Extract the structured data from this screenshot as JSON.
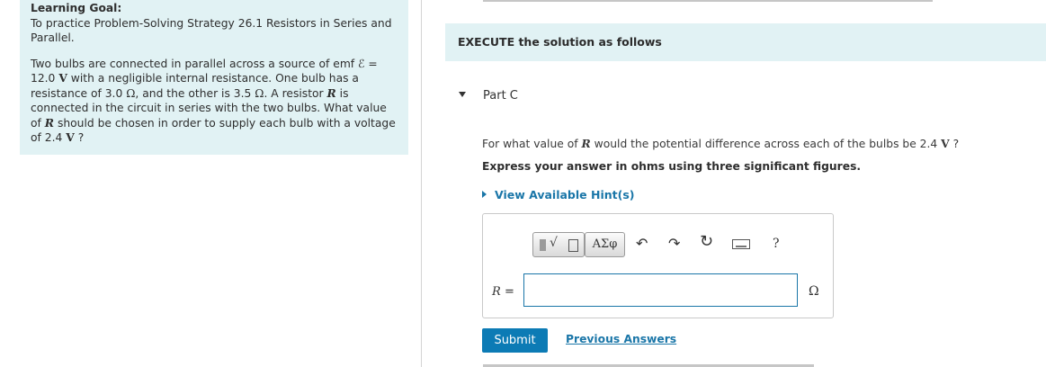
{
  "goal": {
    "title": "Learning Goal:",
    "subtitle": "To practice Problem-Solving Strategy 26.1 Resistors in Series and Parallel.",
    "p1": "Two bulbs are connected in parallel across a source of emf",
    "emf_symbol": "ℰ",
    "p2": "=",
    "p3": "12.0",
    "volt": "V",
    "p4": "with a negligible internal resistance. One bulb has a resistance of 3.0",
    "ohm": "Ω",
    "p5": ", and the other is 3.5",
    "p6": ". A resistor",
    "R": "R",
    "p7": "is connected in the circuit in series with the two bulbs. What value of",
    "p8": "should be chosen in order to supply each bulb with a voltage of 2.4",
    "p9": "?"
  },
  "execute": "EXECUTE the solution as follows",
  "part": {
    "title": "Part C"
  },
  "question": {
    "q1": "For what value of",
    "R": "R",
    "q2": "would the potential difference across each of the bulbs be 2.4",
    "volt": "V",
    "q3": "?",
    "instruction": "Express your answer in ohms using three significant figures."
  },
  "hint": {
    "label": "View Available Hint(s)"
  },
  "toolbar": {
    "templates_icon": "templates-radical-icon",
    "greek_label": "ΑΣφ",
    "undo_glyph": "↶",
    "redo_glyph": "↷",
    "reset_glyph": "↻",
    "keyboard_icon": "keyboard-icon",
    "help_label": "?"
  },
  "answer": {
    "label_var": "R",
    "label_eq": "=",
    "value": "",
    "unit": "Ω"
  },
  "buttons": {
    "submit": "Submit",
    "previous": "Previous Answers"
  },
  "colors": {
    "panel_bg": "#e1f2f4",
    "accent": "#1a76a8",
    "submit_bg": "#0c7bb5"
  }
}
